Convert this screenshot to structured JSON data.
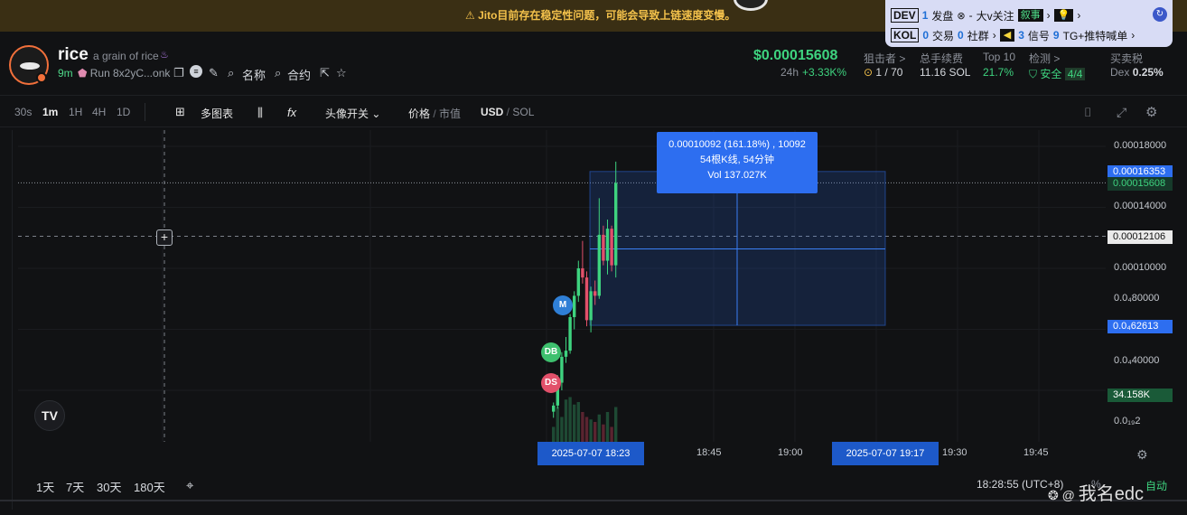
{
  "banner": {
    "warning_icon": "warning-icon",
    "text": "Jito目前存在稳定性问题，可能会导致上链速度变慢。"
  },
  "dev_panel": {
    "row1": {
      "tag": "DEV",
      "launch_count": "1",
      "launch_label": "发盘",
      "follow_value": "-",
      "follow_label": "大v关注",
      "story_label": "叙事"
    },
    "row2": {
      "tag": "KOL",
      "trades_count": "0",
      "trades_label": "交易",
      "community_count": "0",
      "community_label": "社群",
      "signals_count": "3",
      "signals_label": "信号",
      "tg_count": "9",
      "tg_label": "TG+推特喊单"
    }
  },
  "token": {
    "name": "rice",
    "subtitle": "a grain of rice",
    "age": "9m",
    "launchpad": "Run",
    "address": "8x2yC...onk",
    "nav_name": "名称",
    "nav_contract": "合约"
  },
  "price": {
    "value": "$0.00015608",
    "change_label": "24h",
    "change_value": "+3.33K%"
  },
  "stats": [
    {
      "key": "狙击者 >",
      "value": "1 / 70"
    },
    {
      "key": "总手续费",
      "value": "11.16 SOL"
    },
    {
      "key": "Top 10",
      "value": "21.7%"
    },
    {
      "key": "检测 >",
      "value": "安全",
      "badge": "4/4"
    },
    {
      "key": "买卖税",
      "value_label": "Dex",
      "value": "0.25%"
    }
  ],
  "toolbar": {
    "intervals": [
      "30s",
      "1m",
      "1H",
      "4H",
      "1D"
    ],
    "active_interval": "1m",
    "multi_chart": "多图表",
    "avatar_toggle": "头像开关",
    "price_label": "价格",
    "mcap_label": "市值",
    "usd_label": "USD",
    "sol_label": "SOL"
  },
  "chart_data": {
    "type": "candlestick",
    "price_axis_ticks": [
      "0.00018000",
      "0.00014000",
      "0.00010000",
      "0.0₄80000",
      "0.0₄40000",
      "0.0₁₉2"
    ],
    "price_labels_highlight": [
      {
        "value": "0.00016353",
        "color": "#2d6ef0"
      },
      {
        "value": "0.00015608",
        "color": "#3ed37f"
      },
      {
        "value": "0.00012106",
        "color": "#ffffff"
      },
      {
        "value": "0.0₄62613",
        "color": "#2d6ef0"
      },
      {
        "value": "34.158K",
        "color": "#3ed37f"
      }
    ],
    "time_ticks": [
      "18:45",
      "19:00",
      "19:30",
      "19:45"
    ],
    "time_highlight_start": "2025-07-07   18:23",
    "time_highlight_end": "2025-07-07   19:17",
    "measure": {
      "line1": "0.00010092 (161.18%) , 10092",
      "line2": "54根K线, 54分钟",
      "line3": "Vol 137.027K"
    },
    "candles": [
      {
        "o": 6e-06,
        "h": 1.2e-05,
        "l": 2e-06,
        "c": 1e-05,
        "up": true
      },
      {
        "o": 1e-05,
        "h": 3e-05,
        "l": 8e-06,
        "c": 2.5e-05,
        "up": true
      },
      {
        "o": 2.5e-05,
        "h": 4.5e-05,
        "l": 2e-05,
        "c": 4.2e-05,
        "up": true
      },
      {
        "o": 4.2e-05,
        "h": 5.5e-05,
        "l": 3.8e-05,
        "c": 4.6e-05,
        "up": true
      },
      {
        "o": 4.6e-05,
        "h": 7e-05,
        "l": 4.4e-05,
        "c": 6.8e-05,
        "up": true
      },
      {
        "o": 6.8e-05,
        "h": 8.5e-05,
        "l": 6e-05,
        "c": 8.2e-05,
        "up": true
      },
      {
        "o": 8.2e-05,
        "h": 0.000105,
        "l": 7.8e-05,
        "c": 0.0001,
        "up": true
      },
      {
        "o": 0.0001,
        "h": 0.000118,
        "l": 9e-05,
        "c": 9.4e-05,
        "up": false
      },
      {
        "o": 9.4e-05,
        "h": 9.8e-05,
        "l": 6.2e-05,
        "c": 6.6e-05,
        "up": false
      },
      {
        "o": 6.6e-05,
        "h": 8.8e-05,
        "l": 5.8e-05,
        "c": 8.5e-05,
        "up": true
      },
      {
        "o": 8.5e-05,
        "h": 9.2e-05,
        "l": 7.6e-05,
        "c": 8.2e-05,
        "up": false
      },
      {
        "o": 8.2e-05,
        "h": 0.000146,
        "l": 8e-05,
        "c": 0.000122,
        "up": true
      },
      {
        "o": 0.000122,
        "h": 0.000128,
        "l": 0.000102,
        "c": 0.000105,
        "up": false
      },
      {
        "o": 0.000105,
        "h": 0.000132,
        "l": 9.6e-05,
        "c": 0.000126,
        "up": true
      },
      {
        "o": 0.000126,
        "h": 0.000128,
        "l": 9.8e-05,
        "c": 0.000102,
        "up": false
      },
      {
        "o": 0.000102,
        "h": 0.00017,
        "l": 9.4e-05,
        "c": 0.000156,
        "up": true
      }
    ],
    "volumes": [
      0.3,
      0.7,
      0.5,
      0.85,
      0.9,
      0.75,
      0.8,
      0.6,
      0.5,
      0.45,
      0.4,
      0.55,
      0.35,
      0.6,
      0.3,
      0.7
    ],
    "markers": [
      {
        "label": "M",
        "color": "#2f7fd6"
      },
      {
        "label": "DB",
        "color": "#3ec06e"
      },
      {
        "label": "DS",
        "color": "#e2506a"
      }
    ]
  },
  "bottom": {
    "ranges": [
      "1天",
      "7天",
      "30天",
      "180天"
    ],
    "timestamp": "18:28:55 (UTC+8)",
    "pct": "%",
    "log": "log",
    "auto": "自动"
  },
  "watermark": "我名edc"
}
